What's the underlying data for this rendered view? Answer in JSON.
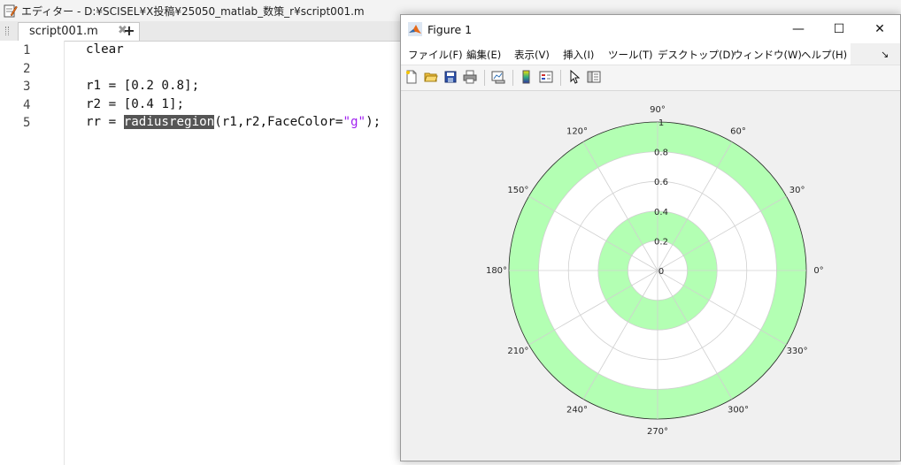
{
  "editor": {
    "window_title": "エディター - D:¥SCISEL¥X投稿¥25050_matlab_数策_r¥script001.m",
    "tab_label": "script001.m",
    "tab_close": "✖",
    "tab_add": "+",
    "line_numbers": [
      "1",
      "2",
      "3",
      "4",
      "5"
    ],
    "lines": {
      "l1": "clear",
      "l3": "r1 = [0.2 0.8];",
      "l4": "r2 = [0.4 1];",
      "l5_prefix": "rr = ",
      "l5_highlight": "radiusregion",
      "l5_mid": "(r1,r2,FaceColor=",
      "l5_string": "\"g\"",
      "l5_suffix": ");"
    }
  },
  "figure": {
    "title": "Figure 1",
    "window_buttons": {
      "minimize": "—",
      "maximize": "☐",
      "close": "✕"
    },
    "menus": [
      "ファイル(F)",
      "編集(E)",
      "表示(V)",
      "挿入(I)",
      "ツール(T)",
      "デスクトップ(D)",
      "ウィンドウ(W)",
      "ヘルプ(H)"
    ],
    "menu_overflow": "↘",
    "toolbar_icons": [
      "new-figure-icon",
      "open-file-icon",
      "save-icon",
      "print-icon",
      "link-plot-icon",
      "colorbar-icon",
      "legend-icon",
      "pointer-icon",
      "property-inspector-icon"
    ]
  },
  "chart_data": {
    "type": "polar",
    "theta_ticks": [
      "0°",
      "30°",
      "60°",
      "90°",
      "120°",
      "150°",
      "180°",
      "210°",
      "240°",
      "270°",
      "300°",
      "330°"
    ],
    "r_ticks": [
      "0",
      "0.2",
      "0.4",
      "0.6",
      "0.8",
      "1"
    ],
    "r_values": [
      0,
      0.2,
      0.4,
      0.6,
      0.8,
      1
    ],
    "rlim": [
      0,
      1
    ],
    "regions": [
      {
        "r_inner": 0.2,
        "r_outer": 0.4
      },
      {
        "r_inner": 0.8,
        "r_outer": 1.0
      }
    ],
    "face_color": "#b3ffb3",
    "grid": true,
    "background": "#ffffff"
  }
}
